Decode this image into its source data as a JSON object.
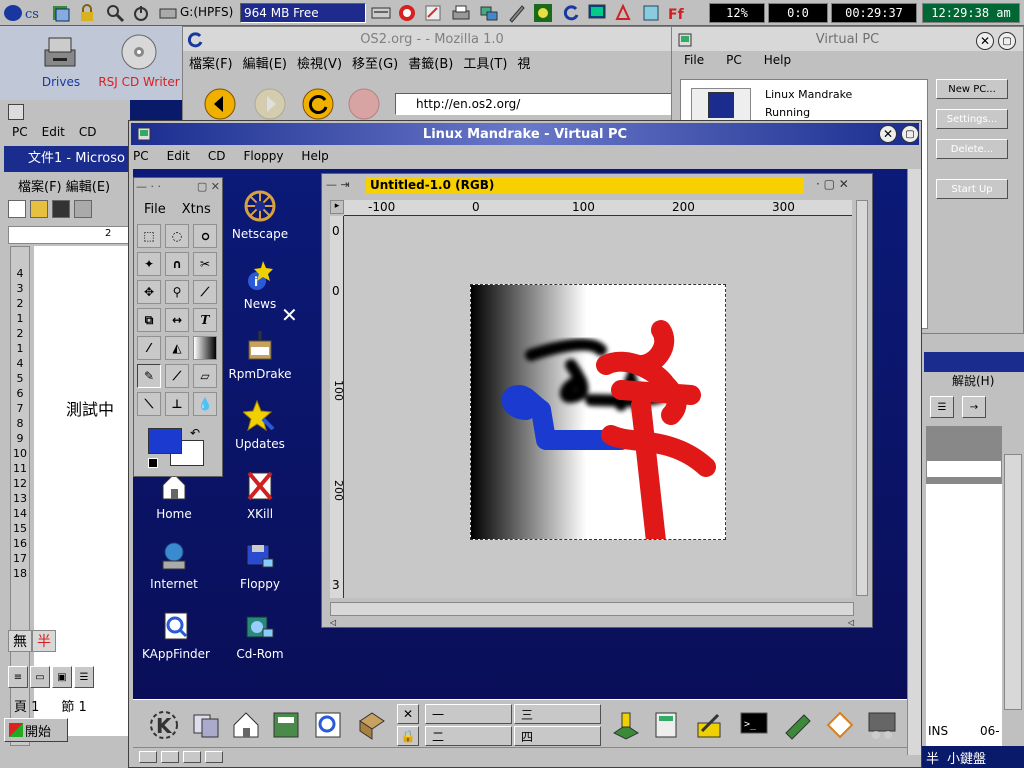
{
  "warpcenter": {
    "drive_label": "G:(HPFS)",
    "memory": "964 MB Free",
    "cpu": "12%",
    "counter": "0:0",
    "uptime": "00:29:37",
    "clock": "12:29:38 am"
  },
  "desktop_icons": [
    {
      "label": "Drives",
      "icon": "drives-icon"
    },
    {
      "label": "RSJ CD Writer",
      "icon": "cd-writer-icon"
    }
  ],
  "mozilla": {
    "title": "OS2.org - - Mozilla 1.0",
    "menu": [
      "檔案(F)",
      "編輯(E)",
      "檢視(V)",
      "移至(G)",
      "書籤(B)",
      "工具(T)",
      "視"
    ],
    "url": "http://en.os2.org/"
  },
  "vpc_manager": {
    "title": "Virtual PC",
    "menu": [
      "File",
      "PC",
      "Help"
    ],
    "vm_name": "Linux Mandrake",
    "vm_status": "Running",
    "buttons": [
      "New PC...",
      "Settings...",
      "Delete...",
      "Start Up"
    ]
  },
  "word": {
    "menu": [
      "PC",
      "Edit",
      "CD"
    ],
    "doc_title": "文件1 - Microso",
    "menu2": [
      "檔案(F)",
      "編輯(E)"
    ],
    "body_text": "測試中",
    "status_page": "頁 1",
    "status_section": "節 1",
    "start": "開始",
    "ime1": "無",
    "ime2": "半",
    "ruler_tick": "2",
    "vertical_ruler": [
      "4",
      "3",
      "2",
      "1",
      "2",
      "1",
      "4",
      "5",
      "6",
      "7",
      "8",
      "9",
      "10",
      "11",
      "12",
      "13",
      "14",
      "15",
      "16",
      "17",
      "18"
    ]
  },
  "right_fragment": {
    "help_menu": "解說(H)",
    "ins": "INS",
    "page": "06-",
    "ime_half": "半",
    "ime_kbd": "小鍵盤"
  },
  "linux_window": {
    "title": "Linux Mandrake - Virtual PC",
    "menu": [
      "PC",
      "Edit",
      "CD",
      "Floppy",
      "Help"
    ]
  },
  "kde_icons": [
    {
      "label": "Netscape",
      "icon": "netscape-icon"
    },
    {
      "label": "News",
      "icon": "news-icon"
    },
    {
      "label": "RpmDrake",
      "icon": "rpmdrake-icon"
    },
    {
      "label": "Updates",
      "icon": "updates-icon"
    },
    {
      "label": "Home",
      "icon": "home-icon"
    },
    {
      "label": "XKill",
      "icon": "xkill-icon"
    },
    {
      "label": "Internet",
      "icon": "internet-icon"
    },
    {
      "label": "Floppy",
      "icon": "floppy-icon"
    },
    {
      "label": "KAppFinder",
      "icon": "kappfinder-icon"
    },
    {
      "label": "Cd-Rom",
      "icon": "cdrom-icon"
    }
  ],
  "gimp_toolbox": {
    "menu": [
      "File",
      "Xtns"
    ],
    "tools": [
      "rect-select",
      "ellipse-select",
      "lasso",
      "fuzzy-select",
      "bezier",
      "scissors",
      "move",
      "zoom",
      "crop",
      "transform",
      "flip",
      "text",
      "color-picker",
      "bucket-fill",
      "blend",
      "pencil",
      "paintbrush",
      "eraser",
      "airbrush",
      "clone",
      "convolve"
    ],
    "fg_color": "#1a3ad0",
    "bg_color": "#ffffff"
  },
  "image_window": {
    "title": "Untitled-1.0 (RGB)",
    "ruler_h": [
      "-100",
      "0",
      "100",
      "200",
      "300"
    ],
    "ruler_v": [
      "0",
      "0",
      "100",
      "200",
      "3"
    ]
  },
  "kpanel": {
    "desktops": [
      "一",
      "三",
      "二",
      "四"
    ]
  }
}
